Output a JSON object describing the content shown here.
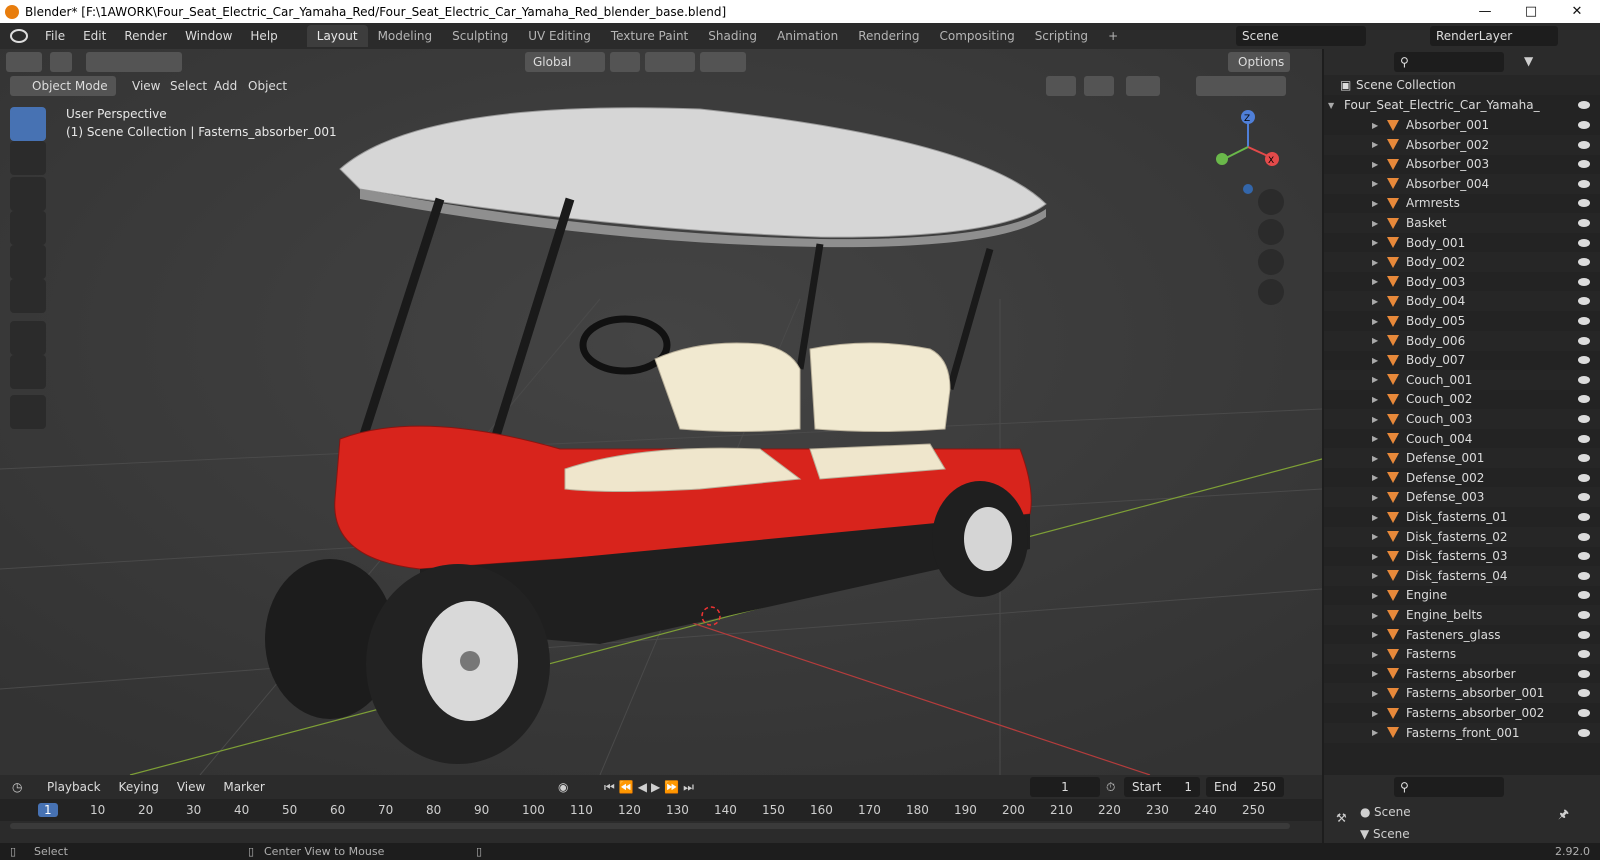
{
  "window": {
    "title": "Blender* [F:\\1AWORK\\Four_Seat_Electric_Car_Yamaha_Red/Four_Seat_Electric_Car_Yamaha_Red_blender_base.blend]"
  },
  "menu": [
    "File",
    "Edit",
    "Render",
    "Window",
    "Help"
  ],
  "workspaces": [
    "Layout",
    "Modeling",
    "Sculpting",
    "UV Editing",
    "Texture Paint",
    "Shading",
    "Animation",
    "Rendering",
    "Compositing",
    "Scripting"
  ],
  "scene": {
    "name": "Scene",
    "renderlayer": "RenderLayer"
  },
  "viewport": {
    "mode": "Object Mode",
    "menus": [
      "View",
      "Select",
      "Add",
      "Object"
    ],
    "transform": "Global",
    "options": "Options",
    "overlay_title": "User Perspective",
    "overlay_sub": "(1) Scene Collection | Fasterns_absorber_001",
    "gizmo": {
      "z": "Z",
      "x": "X"
    }
  },
  "outliner": {
    "root": "Scene Collection",
    "collection": "Four_Seat_Electric_Car_Yamaha_",
    "items": [
      "Absorber_001",
      "Absorber_002",
      "Absorber_003",
      "Absorber_004",
      "Armrests",
      "Basket",
      "Body_001",
      "Body_002",
      "Body_003",
      "Body_004",
      "Body_005",
      "Body_006",
      "Body_007",
      "Couch_001",
      "Couch_002",
      "Couch_003",
      "Couch_004",
      "Defense_001",
      "Defense_002",
      "Defense_003",
      "Disk_fasterns_01",
      "Disk_fasterns_02",
      "Disk_fasterns_03",
      "Disk_fasterns_04",
      "Engine",
      "Engine_belts",
      "Fasteners_glass",
      "Fasterns",
      "Fasterns_absorber",
      "Fasterns_absorber_001",
      "Fasterns_absorber_002",
      "Fasterns_front_001"
    ]
  },
  "timeline": {
    "menus": [
      "Playback",
      "Keying",
      "View",
      "Marker"
    ],
    "current": "1",
    "start_label": "Start",
    "start": "1",
    "end_label": "End",
    "end": "250",
    "ticks": [
      "1",
      "10",
      "20",
      "30",
      "40",
      "50",
      "60",
      "70",
      "80",
      "90",
      "100",
      "110",
      "120",
      "130",
      "140",
      "150",
      "160",
      "170",
      "180",
      "190",
      "200",
      "210",
      "220",
      "230",
      "240",
      "250"
    ]
  },
  "properties": {
    "scene_label": "Scene",
    "scene_section": "Scene"
  },
  "status": {
    "select": "Select",
    "center": "Center View to Mouse",
    "version": "2.92.0"
  }
}
